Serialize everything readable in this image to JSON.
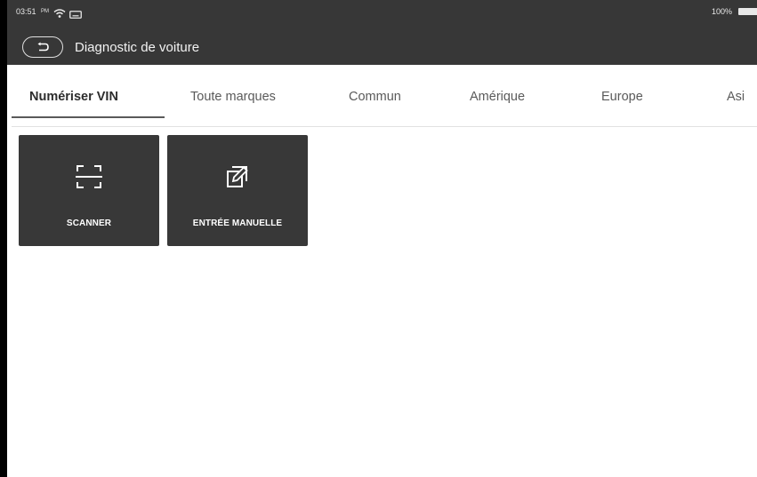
{
  "status_bar": {
    "time": "03:51",
    "ampm": "PM",
    "battery": "100%"
  },
  "header": {
    "title": "Diagnostic de voiture"
  },
  "tabs": [
    {
      "label": "Numériser VIN",
      "active": true
    },
    {
      "label": "Toute marques",
      "active": false
    },
    {
      "label": "Commun",
      "active": false
    },
    {
      "label": "Amérique",
      "active": false
    },
    {
      "label": "Europe",
      "active": false
    },
    {
      "label": "Asi",
      "active": false
    }
  ],
  "tiles": [
    {
      "label": "SCANNER",
      "icon": "scan-frame-icon"
    },
    {
      "label": "ENTRÉE MANUELLE",
      "icon": "edit-copy-icon"
    }
  ],
  "colors": {
    "topbar": "#373737",
    "tile": "#383838",
    "background": "#ffffff"
  }
}
